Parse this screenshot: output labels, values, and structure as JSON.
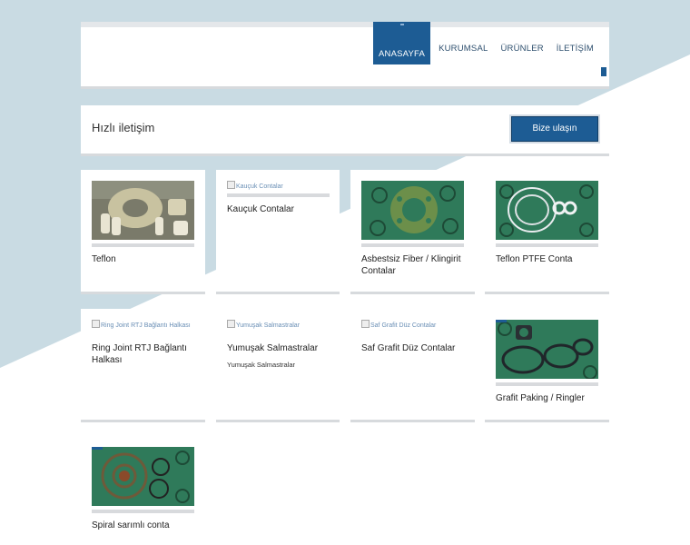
{
  "nav": {
    "items": [
      {
        "label": "ANASAYFA",
        "active": true
      },
      {
        "label": "KURUMSAL",
        "active": false
      },
      {
        "label": "ÜRÜNLER",
        "active": false
      },
      {
        "label": "İLETİŞİM",
        "active": false
      }
    ]
  },
  "contact": {
    "title": "Hızlı iletişim",
    "button_label": "Bize ulaşın"
  },
  "products": [
    {
      "title": "Teflon",
      "image": "teflon-gaskets-photo",
      "broken_alt": ""
    },
    {
      "title": "Kauçuk Contalar",
      "image": "",
      "broken_alt": "Kauçuk Contalar"
    },
    {
      "title": "Asbestsiz Fiber / Klingirit Contalar",
      "image": "fiber-gaskets-photo",
      "broken_alt": ""
    },
    {
      "title": "Teflon PTFE Conta",
      "image": "ptfe-gaskets-photo",
      "broken_alt": ""
    },
    {
      "title": "Ring Joint RTJ Bağlantı Halkası",
      "image": "",
      "broken_alt": "Ring Joint RTJ Bağlantı Halkası"
    },
    {
      "title": "Yumuşak Salmastralar",
      "subtitle": "Yumuşak Salmastralar",
      "image": "",
      "broken_alt": "Yumuşak Salmastralar"
    },
    {
      "title": "Saf Grafit Düz Contalar",
      "image": "",
      "broken_alt": "Saf Grafit Düz Contalar"
    },
    {
      "title": "Grafit Paking / Ringler",
      "image": "graphite-rings-photo",
      "broken_alt": ""
    },
    {
      "title": "Spiral sarımlı conta",
      "image": "spiral-gaskets-photo",
      "broken_alt": ""
    }
  ],
  "colors": {
    "accent": "#1d5c94",
    "background_wedge": "#c9dbe3",
    "card_divider": "#d7dadd"
  }
}
